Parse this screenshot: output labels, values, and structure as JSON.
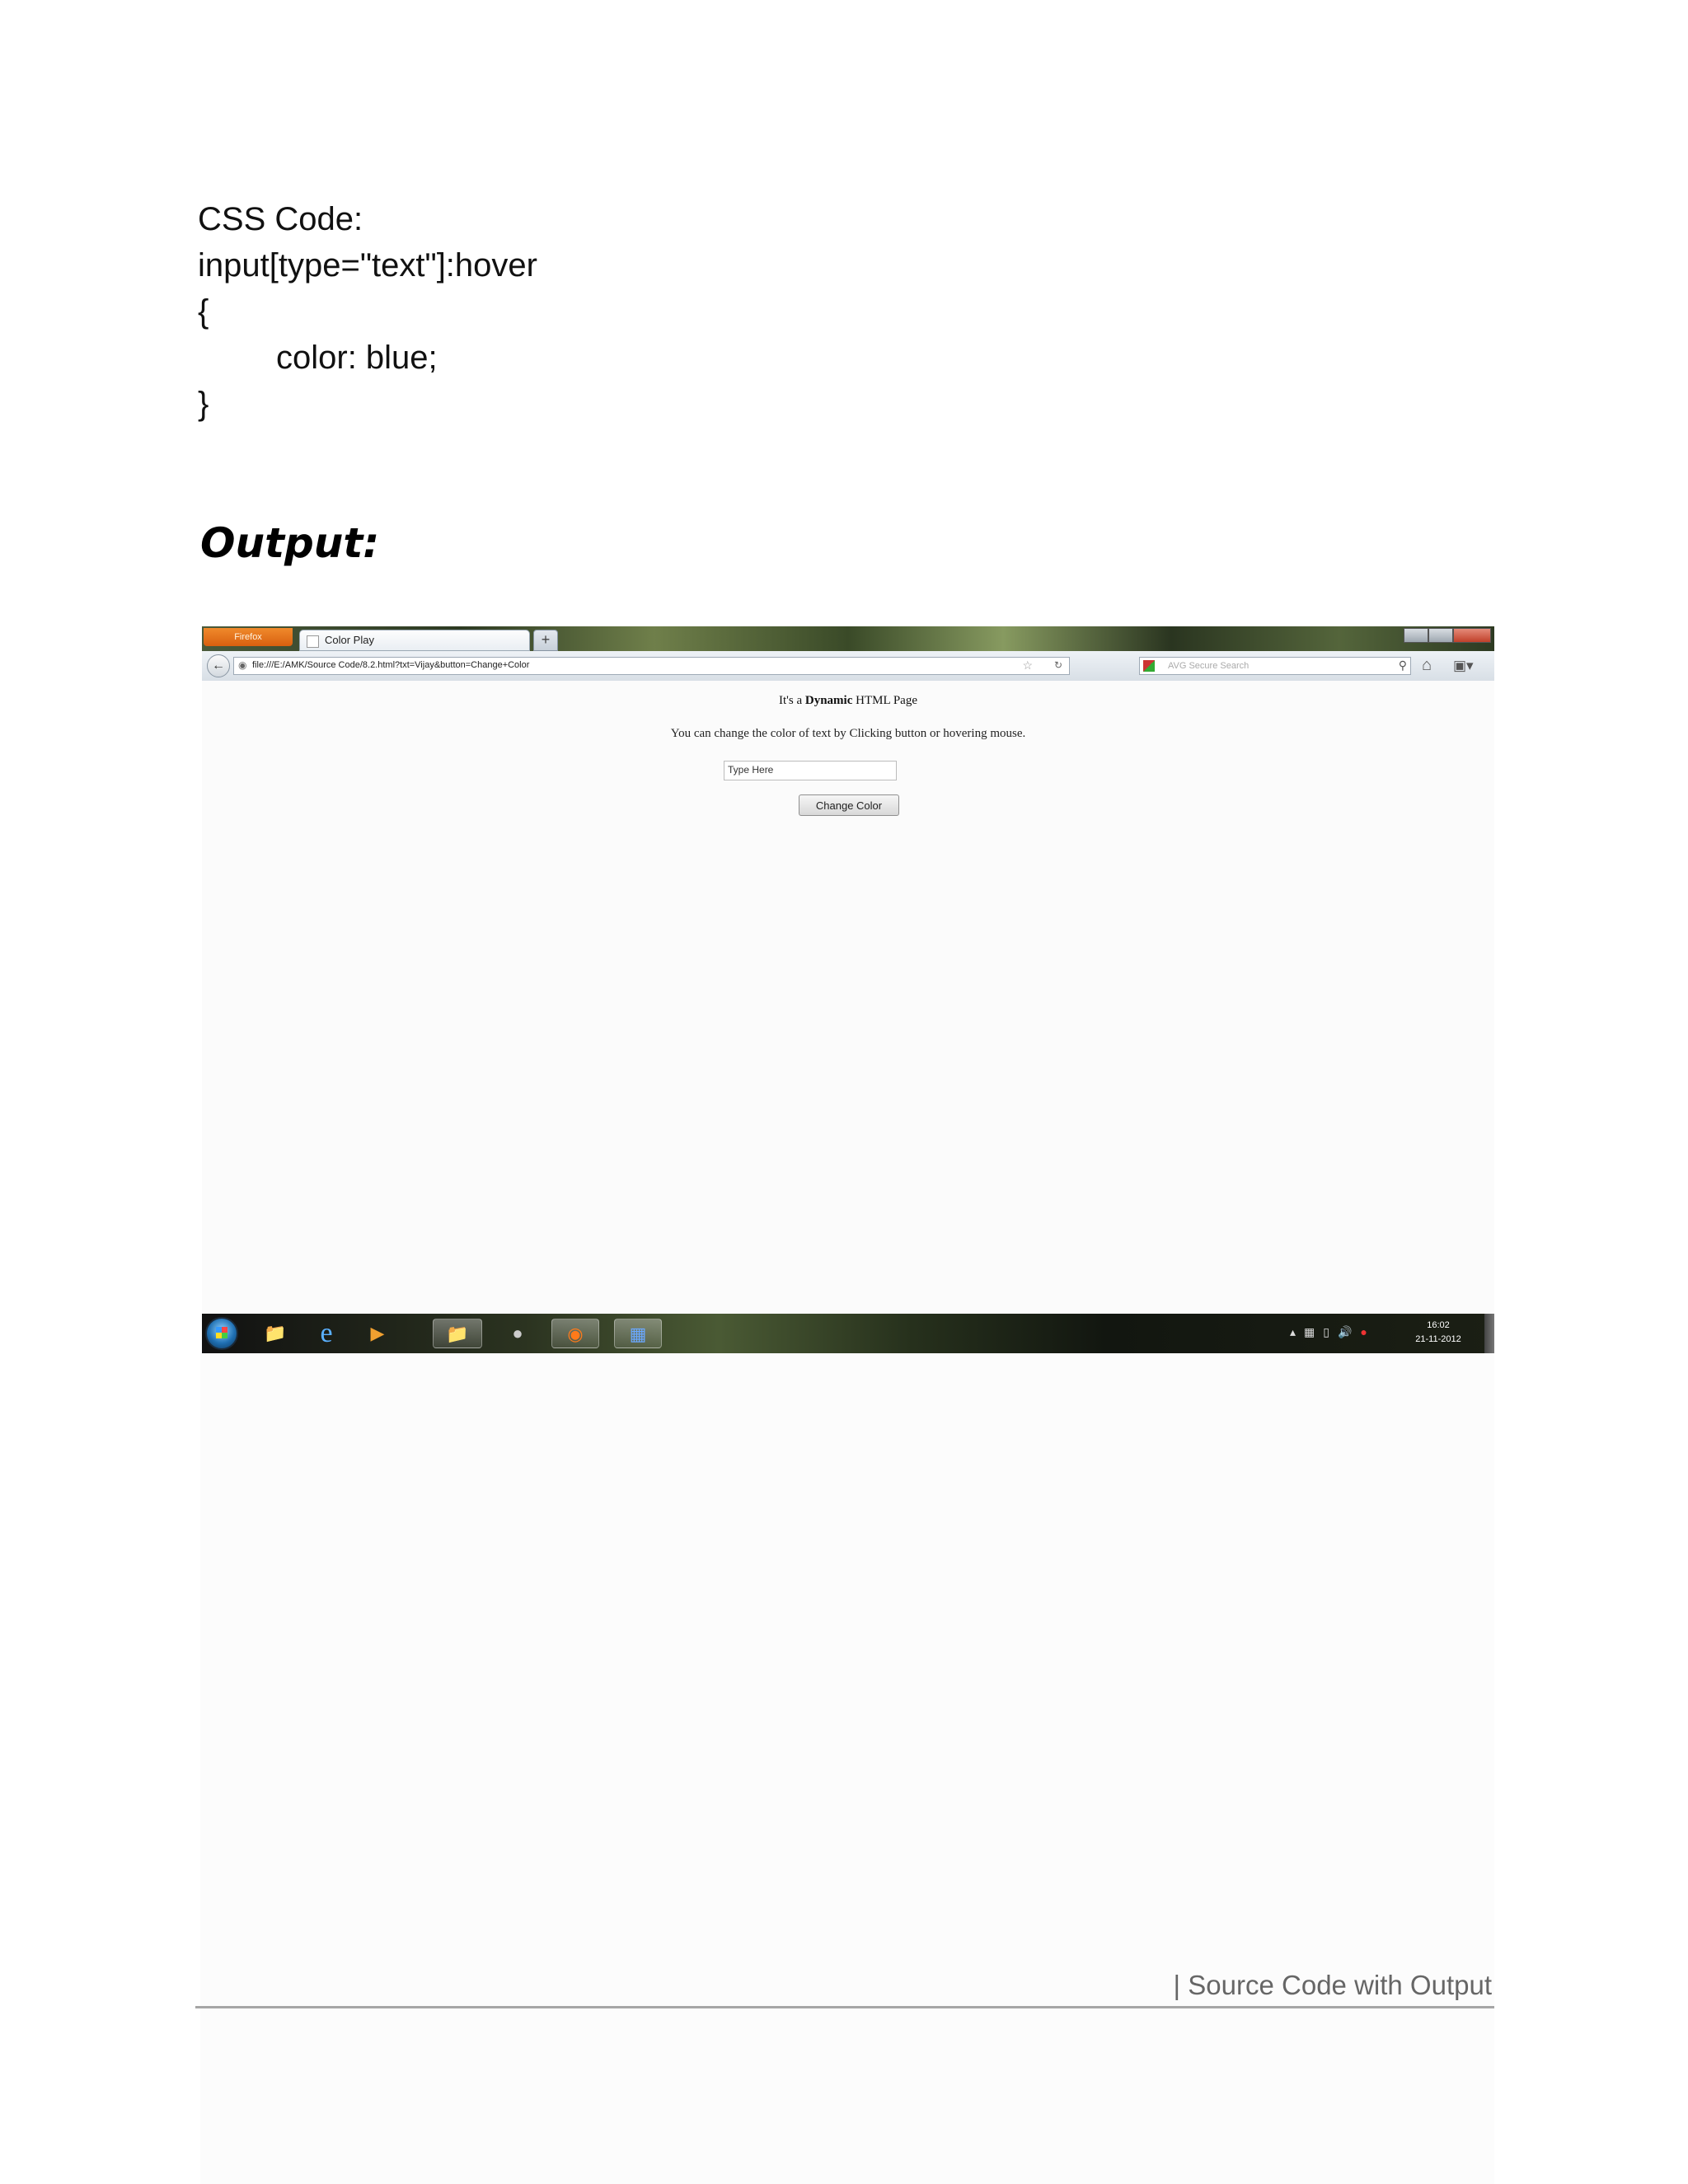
{
  "code": {
    "label": "CSS Code:",
    "selector": "input[type=\"text\"]:hover",
    "open_brace": "{",
    "declaration": "color: blue;",
    "close_brace": "}"
  },
  "output_heading": "Output:",
  "screenshot": {
    "firefox_menu_label": "Firefox",
    "tab_title": "Color Play",
    "new_tab_symbol": "+",
    "url": "file:///E:/AMK/Source Code/8.2.html?txt=Vijay&button=Change+Color",
    "search_placeholder": "AVG Secure Search",
    "page": {
      "heading_prefix": "It's a ",
      "heading_bold": "Dynamic",
      "heading_suffix": " HTML Page",
      "instruction": "You can change the color of text by Clicking button or hovering mouse.",
      "input_value": "Type Here",
      "button_label": "Change Color"
    },
    "taskbar": {
      "apps": [
        "start-orb",
        "library-icon",
        "ie-icon",
        "media-player-icon",
        "explorer-icon",
        "app-icon",
        "firefox-icon",
        "word-icon"
      ],
      "active_app": "firefox-icon",
      "clock_time": "16:02",
      "clock_date": "21-11-2012"
    }
  },
  "footer": {
    "text": "| Source Code with Output"
  }
}
